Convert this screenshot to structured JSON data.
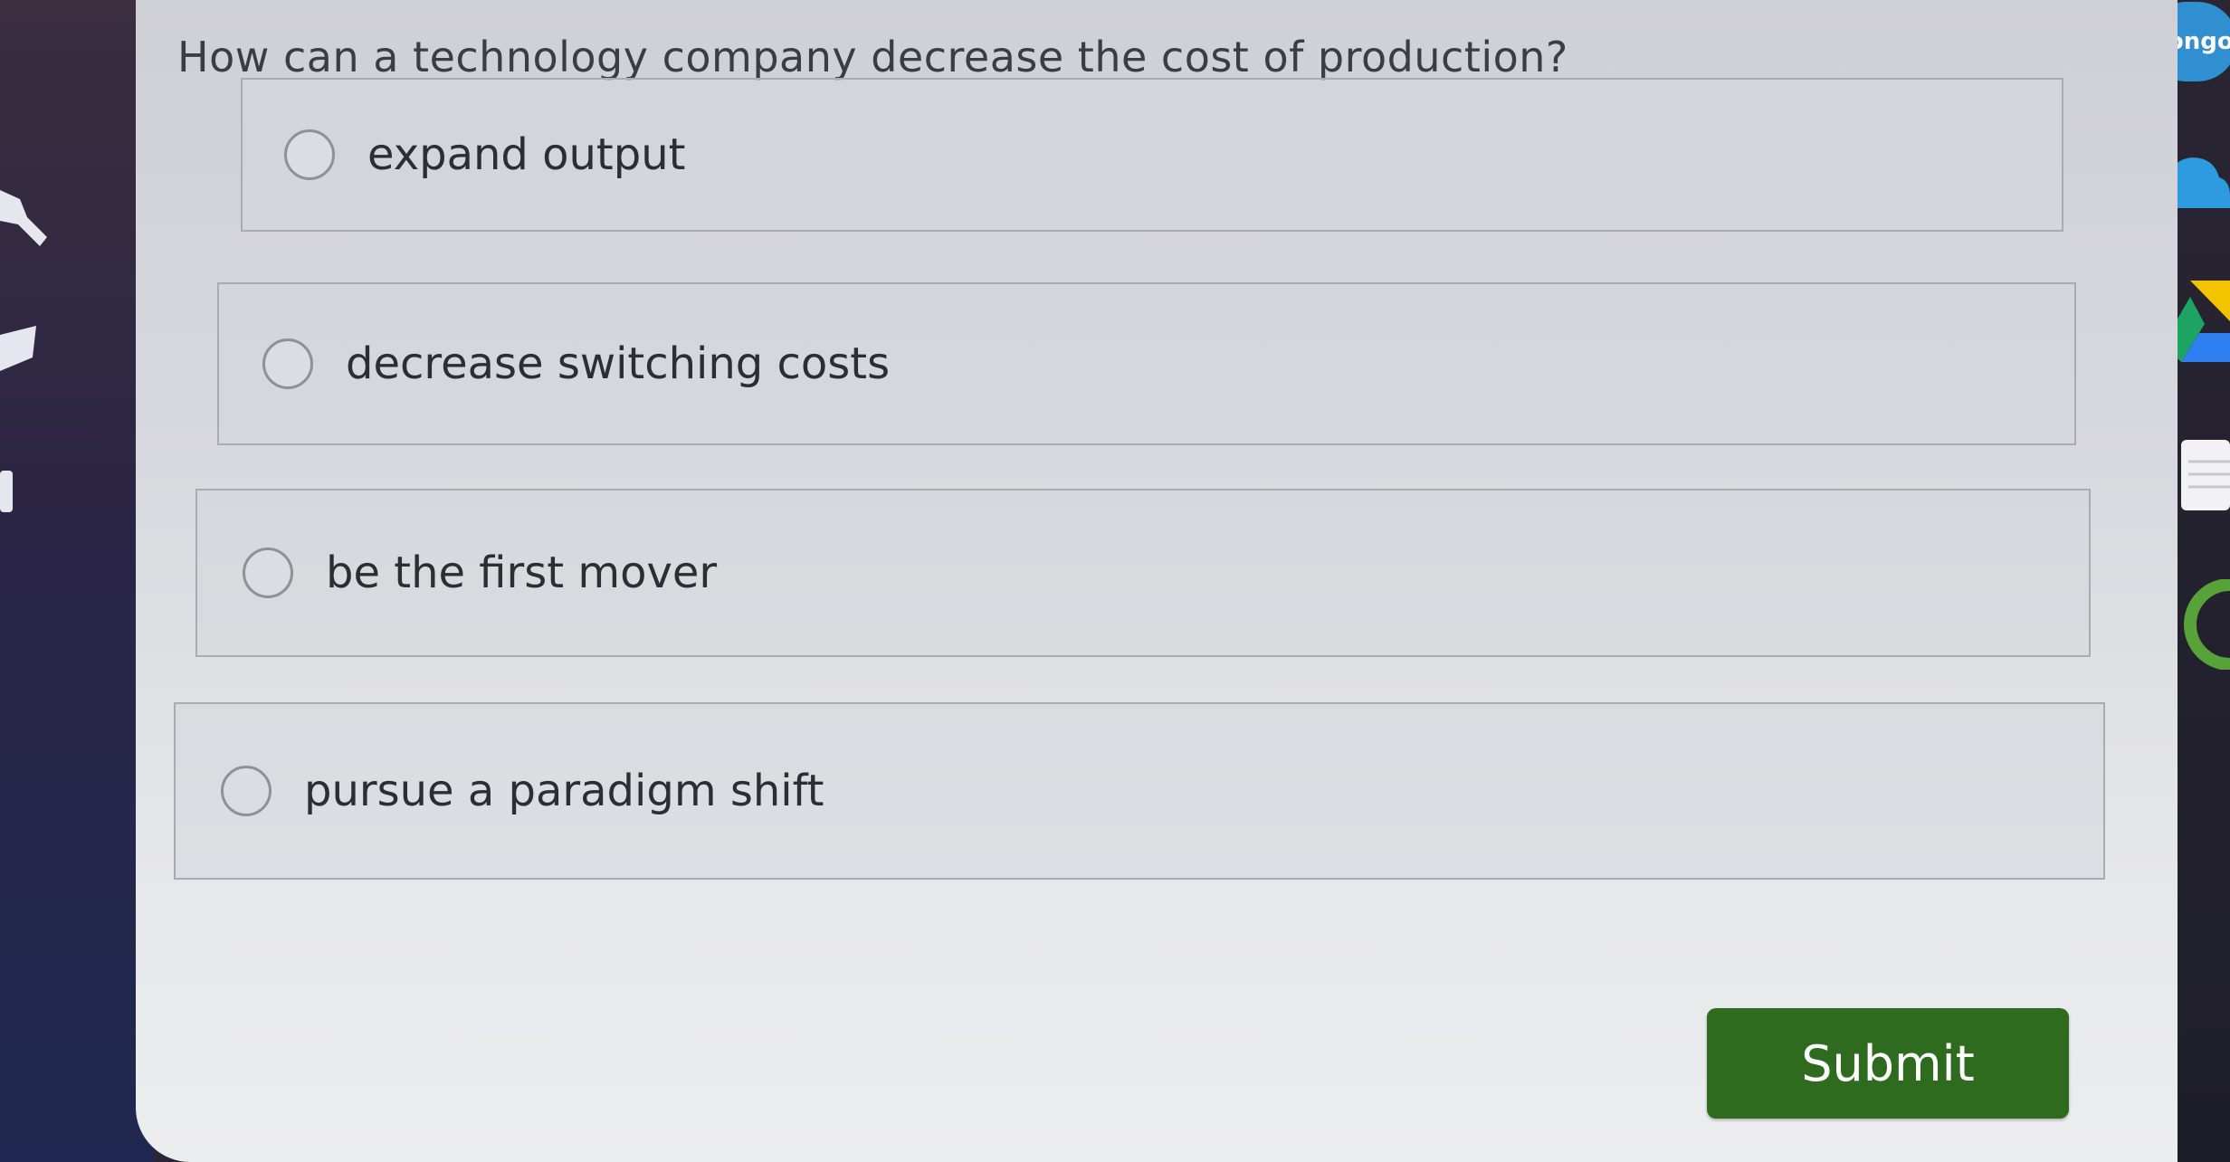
{
  "question": {
    "text": "How can a technology company decrease the cost of production?"
  },
  "options": [
    {
      "label": "expand output"
    },
    {
      "label": "decrease switching costs"
    },
    {
      "label": "be the first mover"
    },
    {
      "label": "pursue a paradigm shift"
    }
  ],
  "submit": {
    "label": "Submit"
  },
  "dock": {
    "bongo_label": "bongo",
    "icons": [
      "bongo-icon",
      "cloud-icon",
      "drive-icon",
      "document-icon",
      "green-circle-icon"
    ]
  },
  "left_icons": [
    "wrench-icon",
    "graduation-cap-icon",
    "tab-icon"
  ],
  "colors": {
    "submit_bg": "#2e6b1f",
    "panel_bg": "#d8d9de",
    "bongo_blue": "#2f8fd0"
  }
}
